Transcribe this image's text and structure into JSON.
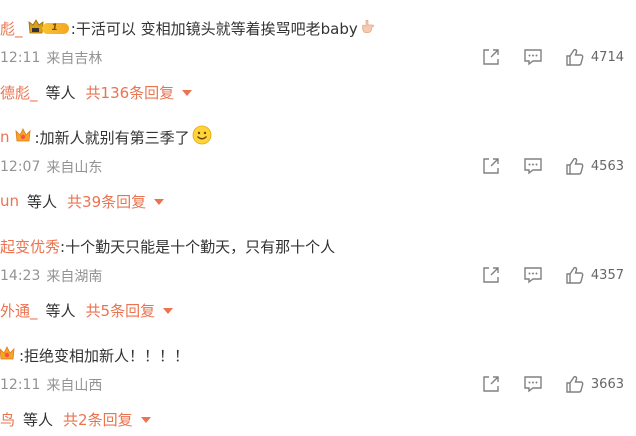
{
  "comments": [
    {
      "user": "彪_",
      "text": ":干活可以 变相加镜头就等着挨骂吧老baby",
      "time": "12:11",
      "location": "来自吉林",
      "likes": "4714",
      "reply_user": "德彪_",
      "reply_others": "等人",
      "reply_total": "共136条回复"
    },
    {
      "user": "n",
      "text": ":加新人就别有第三季了",
      "time": "12:07",
      "location": "来自山东",
      "likes": "4563",
      "reply_user": "un",
      "reply_others": "等人",
      "reply_total": "共39条回复"
    },
    {
      "user": "起变优秀",
      "text": ":十个勤天只能是十个勤天，只有那十个人",
      "time": "14:23",
      "location": "来自湖南",
      "likes": "4357",
      "reply_user": "外通_",
      "reply_others": "等人",
      "reply_total": "共5条回复"
    },
    {
      "user": "",
      "text": ":拒绝变相加新人！！！！",
      "time": "12:11",
      "location": "来自山西",
      "likes": "3663",
      "reply_user": "鸟",
      "reply_others": "等人",
      "reply_total": "共2条回复"
    }
  ],
  "badges": {
    "vip_level": "1"
  },
  "icons": {
    "share": "share-icon",
    "comment": "comment-icon",
    "like": "thumbs-up-icon",
    "expand": "caret-down-icon",
    "crown": "crown-icon",
    "smile": "smile-emoji-icon",
    "hand": "hand-emoji-icon"
  },
  "colors": {
    "accent": "#eb7350",
    "text": "#333333",
    "muted": "#939393",
    "icon": "#808080"
  }
}
